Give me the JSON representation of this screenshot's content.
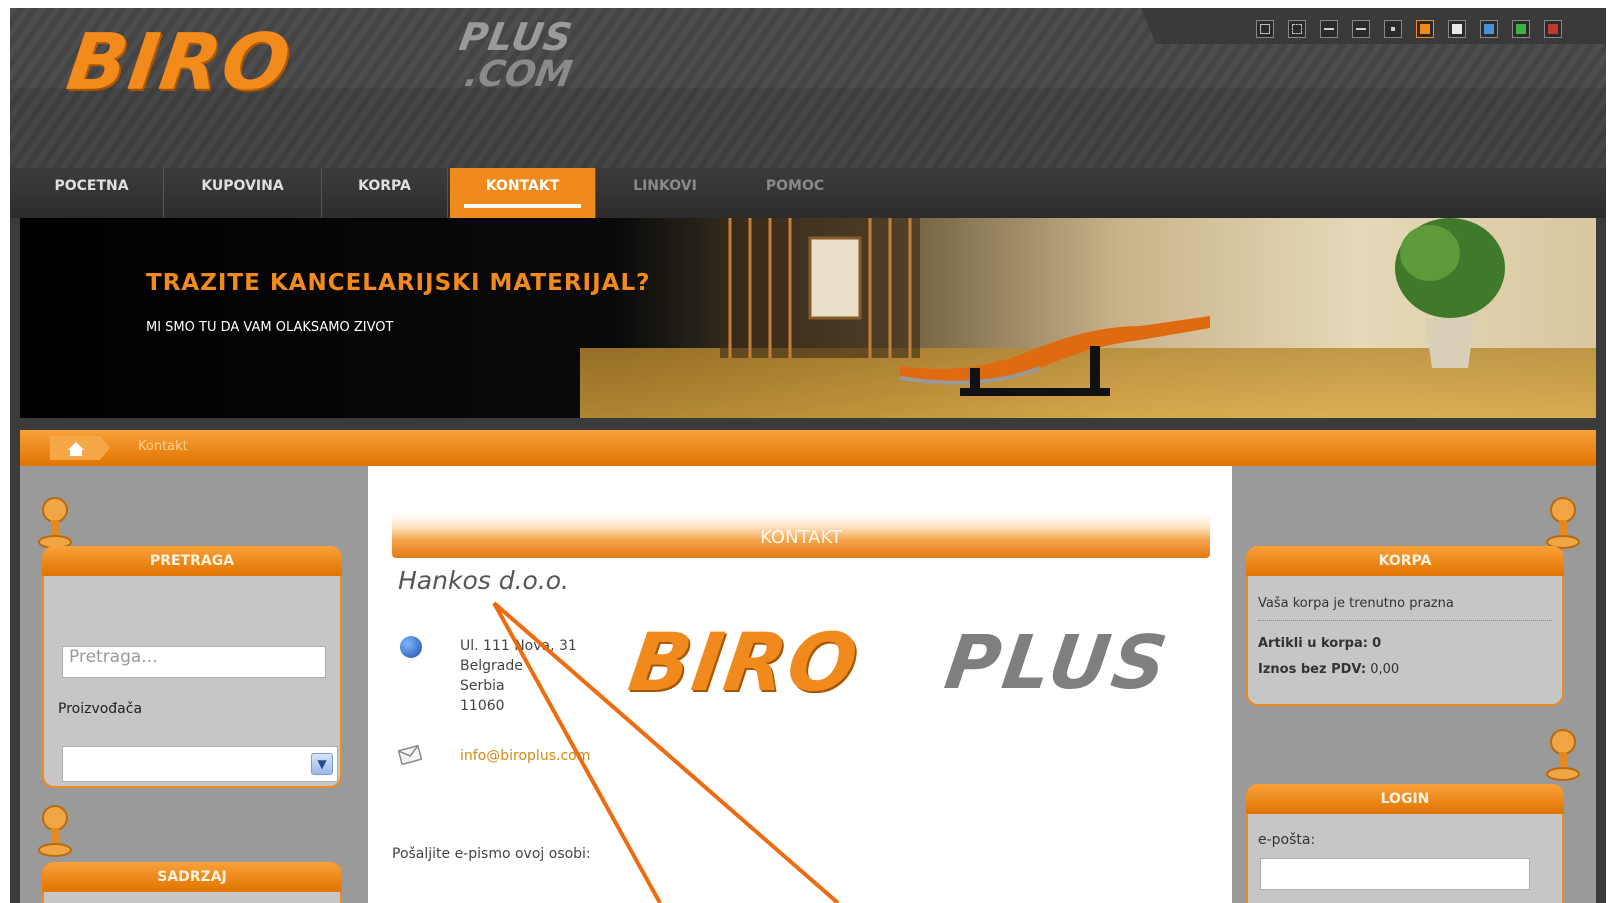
{
  "logo": {
    "main": "BIRO",
    "plus": "PLUS",
    "com": ".COM"
  },
  "style_switcher": {
    "tools": [
      "fit-width-icon",
      "fullscreen-icon",
      "font-increase-icon",
      "font-decrease-icon",
      "font-reset-icon"
    ],
    "colors": [
      "#f08a1c",
      "#e8e8e8",
      "#4a90d9",
      "#3cb043",
      "#c0392b"
    ]
  },
  "nav": {
    "items": [
      {
        "label": "POCETNA"
      },
      {
        "label": "KUPOVINA"
      },
      {
        "label": "KORPA"
      },
      {
        "label": "KONTAKT"
      },
      {
        "label": "LINKOVI"
      },
      {
        "label": "POMOC"
      }
    ],
    "active": "KONTAKT"
  },
  "banner": {
    "title": "TRAZITE KANCELARIJSKI MATERIJAL?",
    "subtitle": "MI SMO TU DA VAM OLAKSAMO ZIVOT"
  },
  "breadcrumb": {
    "current": "Kontakt"
  },
  "left": {
    "search_title": "PRETRAGA",
    "search_placeholder": "Pretraga...",
    "manufacturer_label": "Proizvođača",
    "content_title": "SADRZAJ"
  },
  "main": {
    "header": "KONTAKT",
    "company": "Hankos d.o.o.",
    "address": [
      "Ul. 111 Nova, 31",
      "Belgrade",
      "Serbia",
      "11060"
    ],
    "email": "info@biroplus.com",
    "send_label": "Pošaljite e-pismo ovoj osobi:",
    "logo_main": "BIRO",
    "logo_plus": "PLUS"
  },
  "right": {
    "cart_title": "KORPA",
    "cart_empty": "Vaša korpa je trenutno prazna",
    "items_label": "Artikli u korpa:",
    "items_value": "0",
    "total_label": "Iznos bez PDV:",
    "total_value": "0,00",
    "login_title": "LOGIN",
    "email_label": "e-pošta:"
  },
  "colors": {
    "accent": "#f08a1c",
    "annotation": "#f06a10"
  }
}
